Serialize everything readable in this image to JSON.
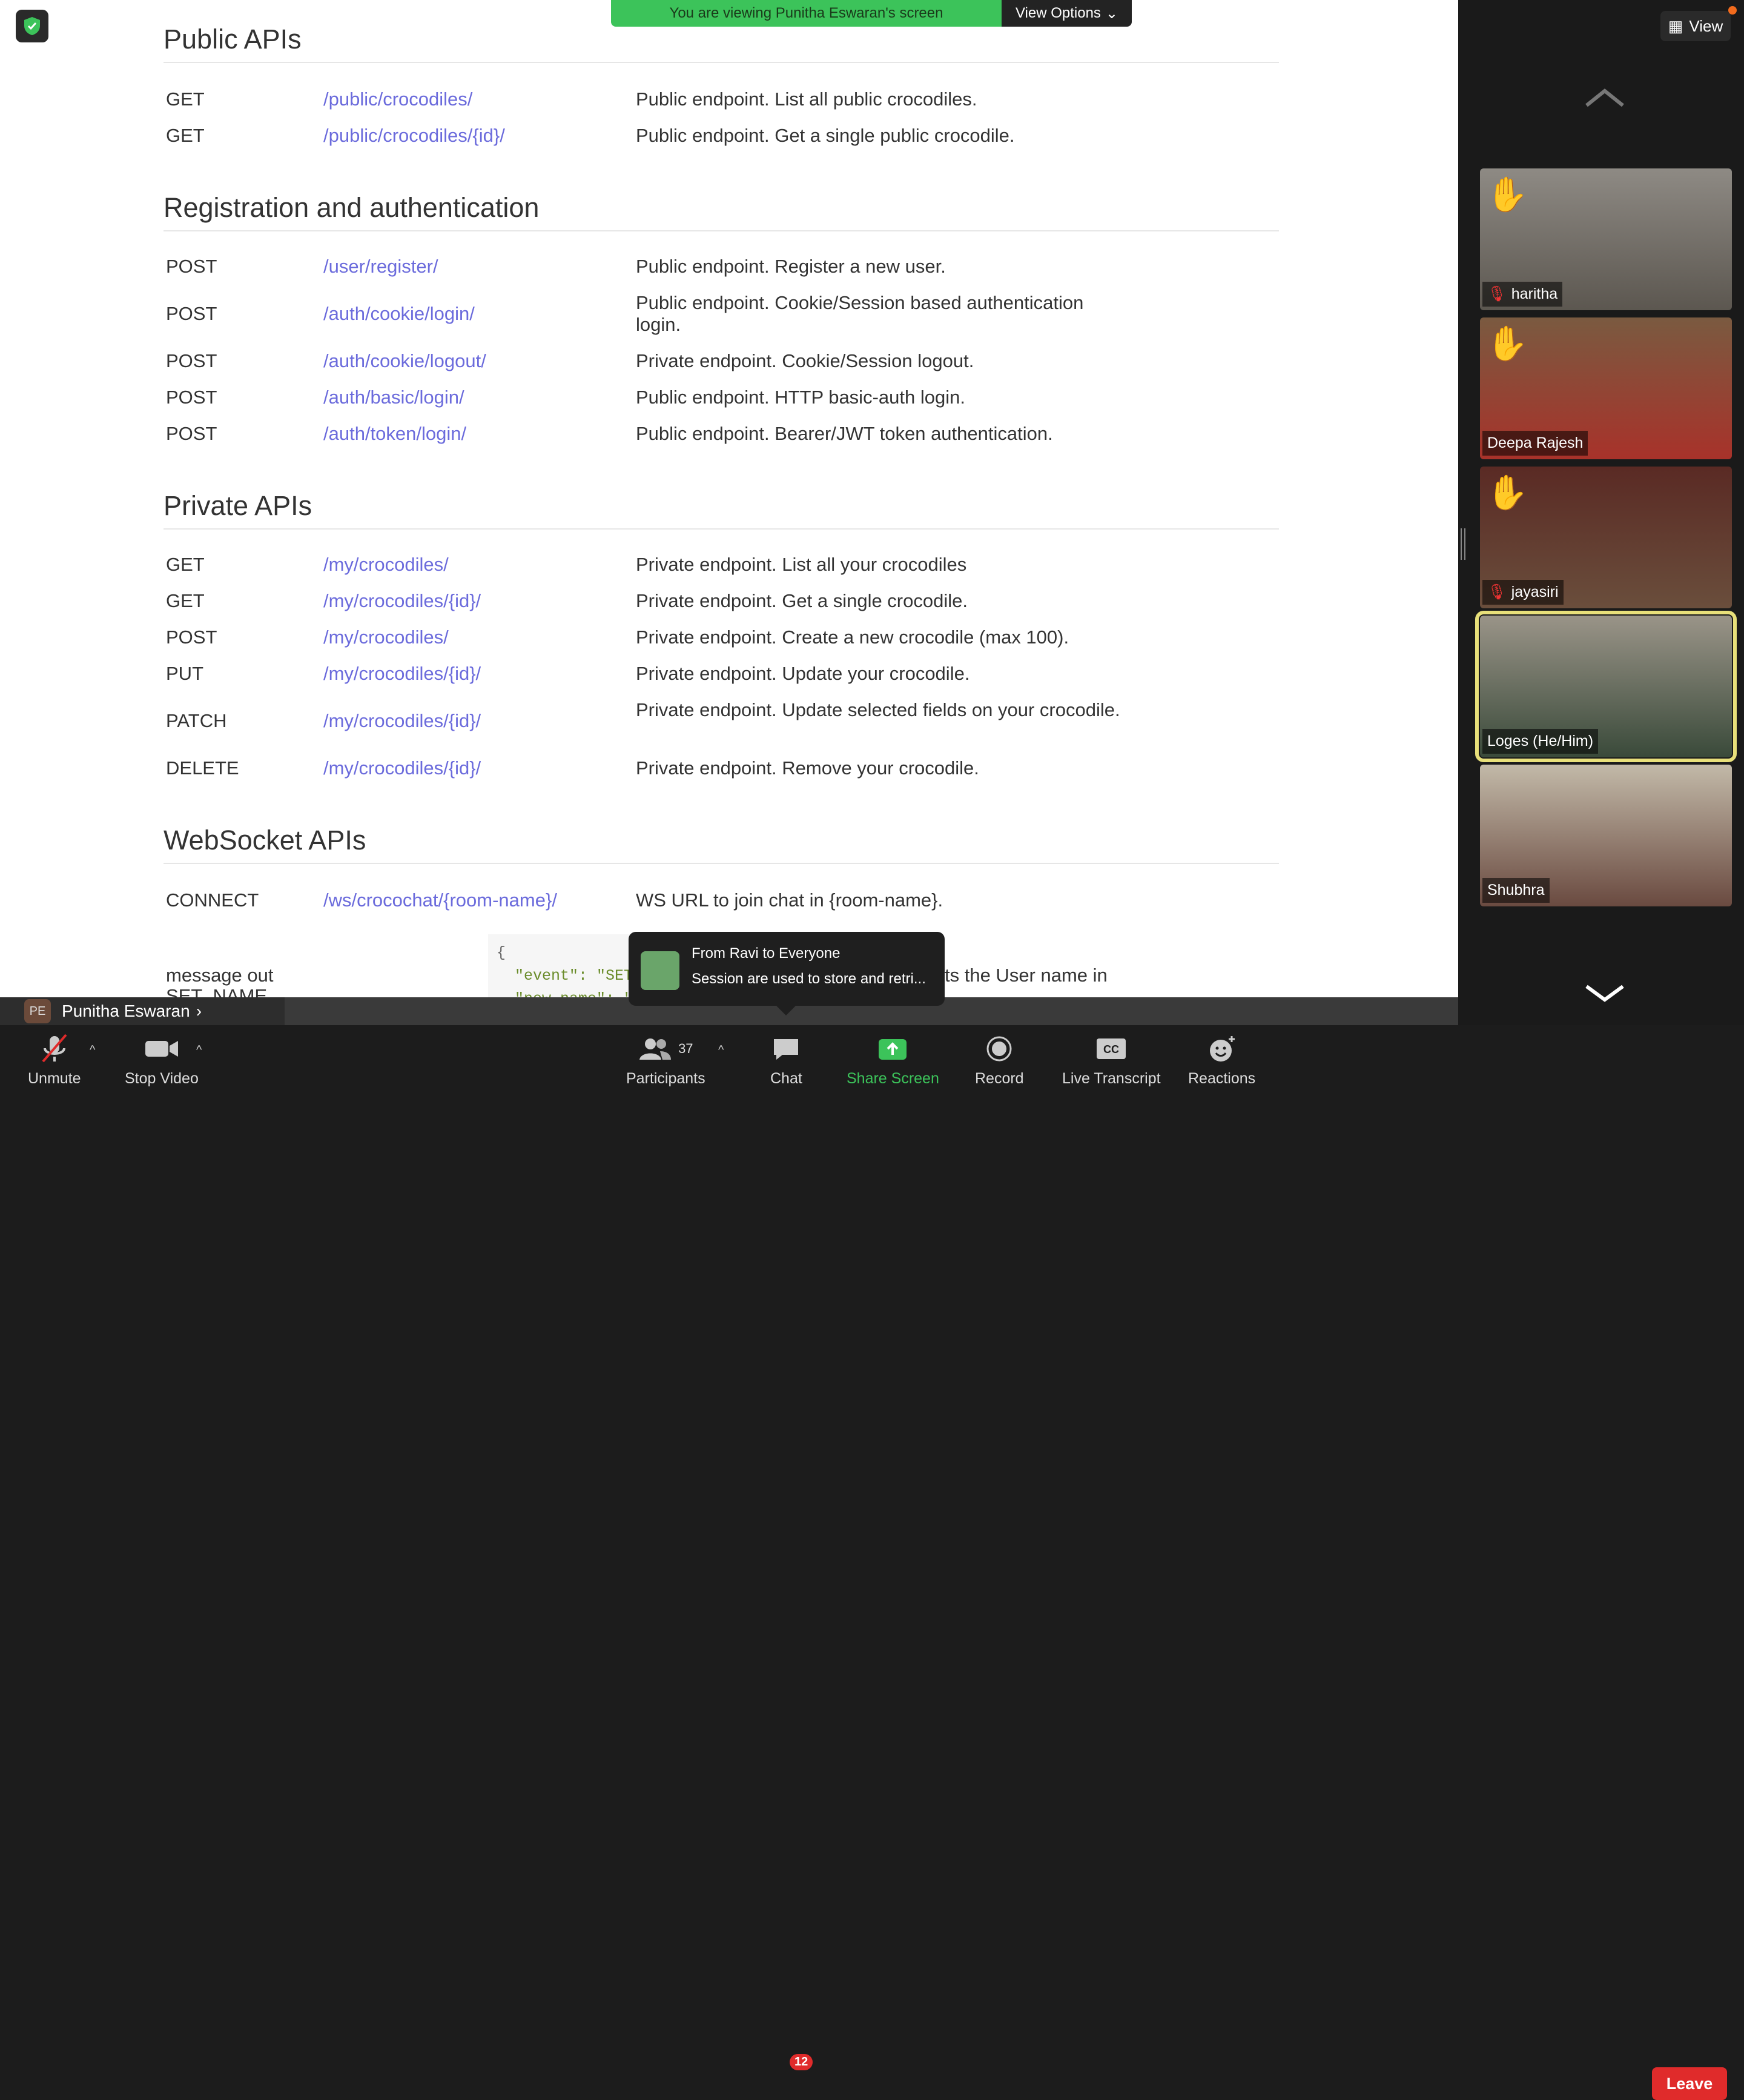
{
  "banner": {
    "message": "You are viewing Punitha Eswaran's screen",
    "options": "View Options"
  },
  "doc": {
    "sections": [
      {
        "title": "Public APIs",
        "rows": [
          {
            "method": "GET",
            "path": "/public/crocodiles/",
            "desc": "Public endpoint. List all public crocodiles."
          },
          {
            "method": "GET",
            "path": "/public/crocodiles/{id}/",
            "desc": "Public endpoint. Get a single public crocodile."
          }
        ]
      },
      {
        "title": "Registration and authentication",
        "rows": [
          {
            "method": "POST",
            "path": "/user/register/",
            "desc": "Public endpoint. Register a new user."
          },
          {
            "method": "POST",
            "path": "/auth/cookie/login/",
            "desc": "Public endpoint. Cookie/Session based authentication login."
          },
          {
            "method": "POST",
            "path": "/auth/cookie/logout/",
            "desc": "Private endpoint. Cookie/Session logout."
          },
          {
            "method": "POST",
            "path": "/auth/basic/login/",
            "desc": "Public endpoint. HTTP basic-auth login."
          },
          {
            "method": "POST",
            "path": "/auth/token/login/",
            "desc": "Public endpoint. Bearer/JWT token authentication."
          }
        ]
      },
      {
        "title": "Private APIs",
        "rows": [
          {
            "method": "GET",
            "path": "/my/crocodiles/",
            "desc": "Private endpoint. List all your crocodiles"
          },
          {
            "method": "GET",
            "path": "/my/crocodiles/{id}/",
            "desc": "Private endpoint. Get a single crocodile."
          },
          {
            "method": "POST",
            "path": "/my/crocodiles/",
            "desc": "Private endpoint. Create a new crocodile (max 100)."
          },
          {
            "method": "PUT",
            "path": "/my/crocodiles/{id}/",
            "desc": "Private endpoint. Update your crocodile."
          },
          {
            "method": "PATCH",
            "path": "/my/crocodiles/{id}/",
            "desc": "Private endpoint. Update selected fields on your crocodile."
          },
          {
            "method": "DELETE",
            "path": "/my/crocodiles/{id}/",
            "desc": "Private endpoint. Remove your crocodile."
          }
        ]
      },
      {
        "title": "WebSocket APIs",
        "rows": [
          {
            "method": "CONNECT",
            "path": "/ws/crocochat/{room-name}/",
            "desc": "WS URL to join chat in {room-name}."
          }
        ]
      }
    ],
    "msg_out_label": "message out",
    "msg_out_sub": "SET_NAME",
    "code": {
      "line1": "{",
      "line2_key": "\"event\"",
      "line2_val": ": \"SET_NAME\",",
      "line3": "\"new_name\": \"MyName\""
    },
    "partial_desc": "ts the User name in"
  },
  "presenter": {
    "initials": "PE",
    "name": "Punitha Eswaran"
  },
  "toast": {
    "title": "From Ravi to Everyone",
    "text": "Session are used to store and retri..."
  },
  "gallery": {
    "view_label": "View",
    "participants": [
      {
        "name": "haritha",
        "muted": true,
        "hand": true,
        "active": false
      },
      {
        "name": "Deepa Rajesh",
        "muted": false,
        "hand": true,
        "active": false
      },
      {
        "name": "jayasiri",
        "muted": true,
        "hand": true,
        "active": false
      },
      {
        "name": "Loges  (He/Him)",
        "muted": false,
        "hand": false,
        "active": true
      },
      {
        "name": "Shubhra",
        "muted": false,
        "hand": false,
        "active": false
      }
    ]
  },
  "toolbar": {
    "unmute": "Unmute",
    "stop_video": "Stop Video",
    "participants": "Participants",
    "participant_count": "37",
    "chat": "Chat",
    "chat_badge": "12",
    "share": "Share Screen",
    "record": "Record",
    "transcript": "Live Transcript",
    "reactions": "Reactions",
    "leave": "Leave"
  },
  "colors": {
    "link": "#6b6bdc",
    "share": "#3cc35a",
    "leave": "#e02b2b",
    "active_tile": "#e8e07a"
  }
}
